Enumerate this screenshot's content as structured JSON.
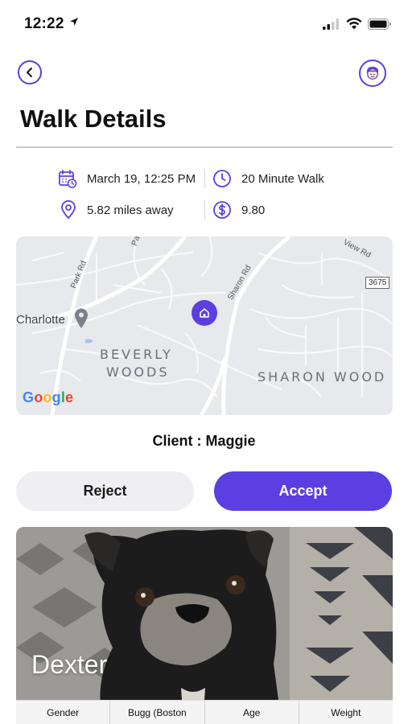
{
  "status_bar": {
    "time": "12:22"
  },
  "header": {
    "title": "Walk Details"
  },
  "info": {
    "date": "March 19, 12:25 PM",
    "duration": "20 Minute Walk",
    "distance": "5.82 miles away",
    "price": "9.80"
  },
  "map": {
    "labels": {
      "charlotte": "Charlotte",
      "beverly": "BEVERLY",
      "woods": "WOODS",
      "sharon_wood": "SHARON WOOD",
      "park_rd": "Park Rd",
      "sharon_rd": "Sharon Rd",
      "view_rd": "View Rd",
      "pa": "Pa",
      "route": "3675"
    },
    "logo": "Google"
  },
  "client": {
    "label": "Client : Maggie"
  },
  "actions": {
    "reject": "Reject",
    "accept": "Accept"
  },
  "dog": {
    "name": "Dexter",
    "stats": [
      "Gender",
      "Bugg (Boston",
      "Age",
      "Weight"
    ]
  },
  "colors": {
    "accent": "#5b3fe0",
    "reject_bg": "#efeff3"
  }
}
